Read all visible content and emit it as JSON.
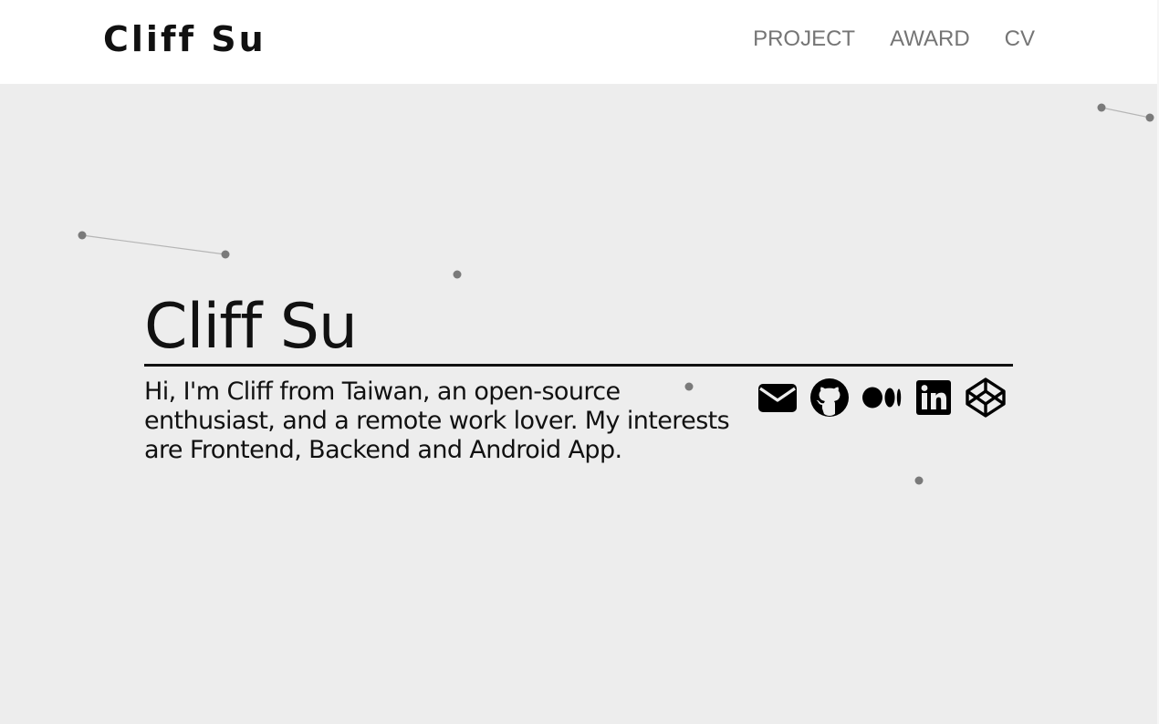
{
  "header": {
    "brand": "Cliff Su",
    "nav": [
      {
        "label": "PROJECT"
      },
      {
        "label": "AWARD"
      },
      {
        "label": "CV"
      }
    ]
  },
  "hero": {
    "title": "Cliff Su",
    "bio": "Hi, I'm Cliff from Taiwan, an open-source enthusiast, and a remote work lover. My interests are Frontend, Backend and Android App.",
    "social": [
      {
        "icon": "envelope-icon"
      },
      {
        "icon": "github-icon"
      },
      {
        "icon": "medium-icon"
      },
      {
        "icon": "linkedin-icon"
      },
      {
        "icon": "codepen-icon"
      }
    ]
  },
  "colors": {
    "header_bg": "#ffffff",
    "page_bg": "#ededed",
    "nav_text": "#757575",
    "text": "#111111",
    "particle": "#7a7a7a",
    "particle_line": "#b5b5b5"
  }
}
